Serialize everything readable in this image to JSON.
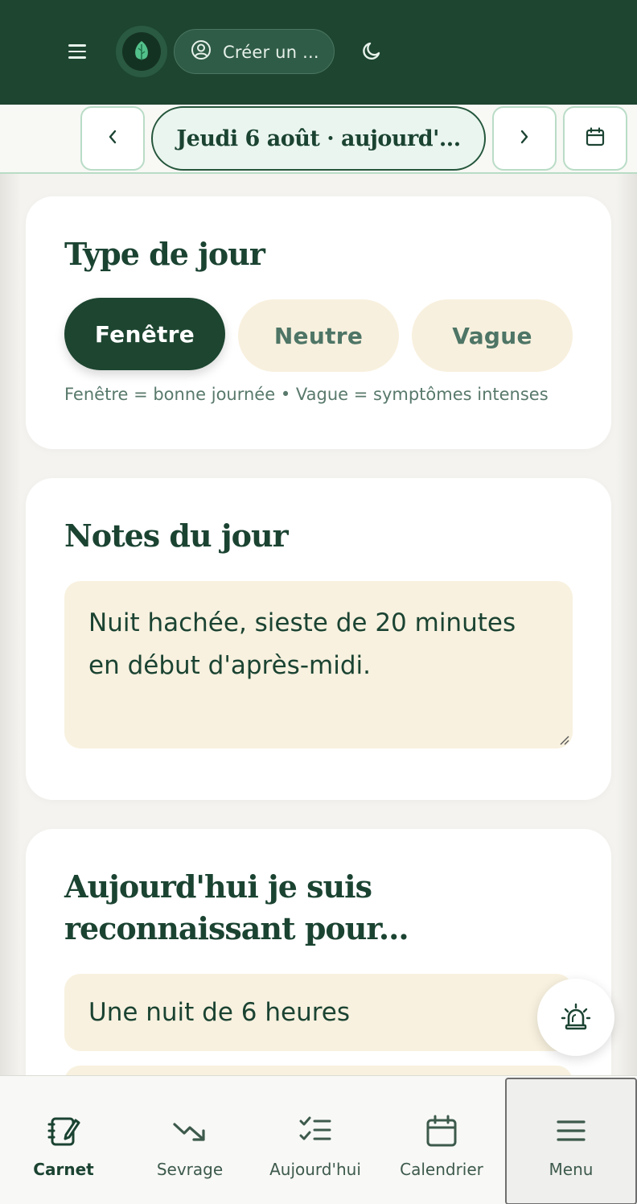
{
  "header": {
    "account_label": "Créer un ...",
    "icons": [
      "menu-icon",
      "leaf-logo",
      "user-circle-icon",
      "moon-icon"
    ]
  },
  "datebar": {
    "date_label": "Jeudi 6 août · aujourd'...",
    "icons": [
      "chevron-left-icon",
      "chevron-right-icon",
      "calendar-icon"
    ]
  },
  "day_type": {
    "title": "Type de jour",
    "options": [
      "Fenêtre",
      "Neutre",
      "Vague"
    ],
    "selected": "Fenêtre",
    "legend": "Fenêtre = bonne journée • Vague = symptômes intenses"
  },
  "notes": {
    "title": "Notes du jour",
    "value": "Nuit hachée, sieste de 20 minutes en début d'après-midi."
  },
  "gratitude": {
    "title_line1": "Aujourd'hui je suis",
    "title_line2": "reconnaissant pour...",
    "items": [
      "Une nuit de 6 heures",
      ""
    ]
  },
  "bottom_nav": {
    "items": [
      {
        "label": "Carnet",
        "icon": "notebook-edit-icon",
        "active": true
      },
      {
        "label": "Sevrage",
        "icon": "trending-down-icon",
        "active": false
      },
      {
        "label": "Aujourd'hui",
        "icon": "checklist-icon",
        "active": false
      },
      {
        "label": "Calendrier",
        "icon": "calendar-icon",
        "active": false
      },
      {
        "label": "Menu",
        "icon": "menu-icon",
        "active": false
      }
    ]
  },
  "colors": {
    "primary": "#1d4530",
    "accent_light": "#b9dcc6",
    "chip_bg": "#f8f0de",
    "background": "#f4f3ef"
  }
}
